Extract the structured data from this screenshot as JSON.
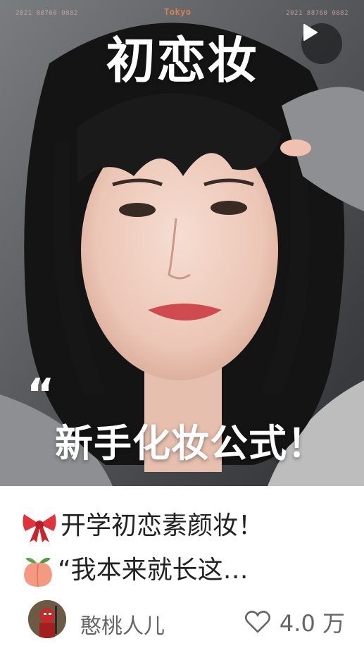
{
  "cover": {
    "overlay_title": "初恋妆",
    "quote_mark": "“",
    "overlay_subtitle": "新手化妆公式！",
    "watermark_left": "2021 88760 0882",
    "watermark_center": "Tokyo",
    "watermark_right": "2021 88760 0882",
    "play_icon": "play-icon"
  },
  "post": {
    "title_line1": "开学初恋素颜妆！",
    "title_line2": "“我本来就长这…",
    "emoji1": "ribbon-bow",
    "emoji2": "peach"
  },
  "footer": {
    "author": "憨桃人儿",
    "likes": "4.0 万",
    "heart_icon": "heart-outline-icon"
  },
  "colors": {
    "text": "#222222",
    "muted": "#666666",
    "ribbon": "#e0343c",
    "peach": "#f49a82"
  }
}
